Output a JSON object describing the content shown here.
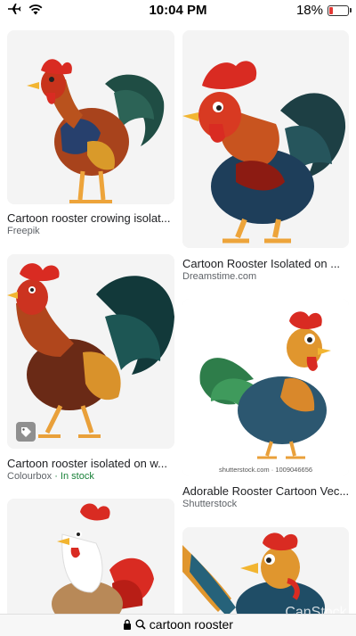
{
  "status_bar": {
    "time": "10:04 PM",
    "battery": "18%",
    "battery_level": 0.18
  },
  "results": [
    {
      "title": "Cartoon rooster crowing isolat...",
      "source": "Freepik"
    },
    {
      "title": "Cartoon Rooster Isolated on ...",
      "source": "Dreamstime.com"
    },
    {
      "title": "Cartoon rooster isolated on w...",
      "source": "Colourbox",
      "stock": " · In stock"
    },
    {
      "title": "Adorable Rooster Cartoon Vec...",
      "source": "Shutterstock",
      "watermark": "shutterstock.com · 1009046656"
    },
    {
      "title": "",
      "source": ""
    },
    {
      "title": "",
      "source": "",
      "watermark": "CanStock"
    }
  ],
  "address_bar": {
    "query": "cartoon rooster"
  },
  "colors": {
    "link_green": "#188038",
    "source_gray": "#5f6368",
    "battery_red": "#e53935"
  }
}
